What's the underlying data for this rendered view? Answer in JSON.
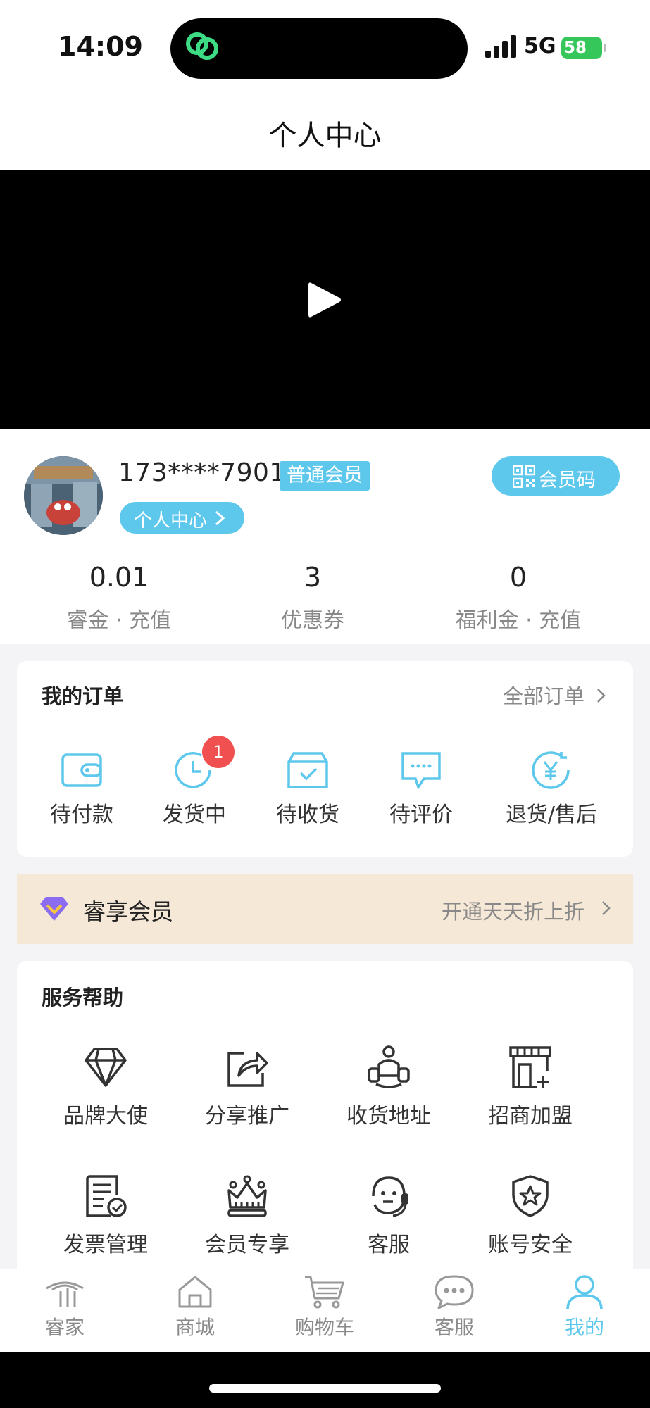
{
  "status": {
    "time": "14:09",
    "network": "5G",
    "battery": "58"
  },
  "header": {
    "title": "个人中心"
  },
  "profile": {
    "phone": "173****7901",
    "level": "普通会员",
    "member_code_label": "会员码",
    "center_label": "个人中心"
  },
  "stats": [
    {
      "value": "0.01",
      "label": "睿金 · 充值"
    },
    {
      "value": "3",
      "label": "优惠券"
    },
    {
      "value": "0",
      "label": "福利金 · 充值"
    }
  ],
  "orders": {
    "title": "我的订单",
    "all_label": "全部订单",
    "items": [
      {
        "label": "待付款",
        "icon": "wallet-icon"
      },
      {
        "label": "发货中",
        "icon": "clock-icon",
        "badge": "1"
      },
      {
        "label": "待收货",
        "icon": "box-check-icon"
      },
      {
        "label": "待评价",
        "icon": "chat-dots-icon"
      },
      {
        "label": "退货/售后",
        "icon": "yen-refund-icon"
      }
    ]
  },
  "vip": {
    "title": "睿享会员",
    "promo": "开通天天折上折"
  },
  "services": {
    "title": "服务帮助",
    "items": [
      {
        "label": "品牌大使",
        "icon": "diamond-icon"
      },
      {
        "label": "分享推广",
        "icon": "share-icon"
      },
      {
        "label": "收货地址",
        "icon": "people-icon"
      },
      {
        "label": "招商加盟",
        "icon": "store-plus-icon"
      },
      {
        "label": "发票管理",
        "icon": "invoice-icon"
      },
      {
        "label": "会员专享",
        "icon": "crown-icon"
      },
      {
        "label": "客服",
        "icon": "headset-icon"
      },
      {
        "label": "账号安全",
        "icon": "shield-star-icon"
      }
    ]
  },
  "tabs": [
    {
      "label": "睿家",
      "icon": "brand-icon"
    },
    {
      "label": "商城",
      "icon": "home-icon"
    },
    {
      "label": "购物车",
      "icon": "cart-icon"
    },
    {
      "label": "客服",
      "icon": "chat-icon"
    },
    {
      "label": "我的",
      "icon": "user-icon",
      "active": true
    }
  ],
  "colors": {
    "accent": "#5ec8ec",
    "badge": "#f05050",
    "vip_bg": "#f6e8d6",
    "battery": "#35c759"
  }
}
